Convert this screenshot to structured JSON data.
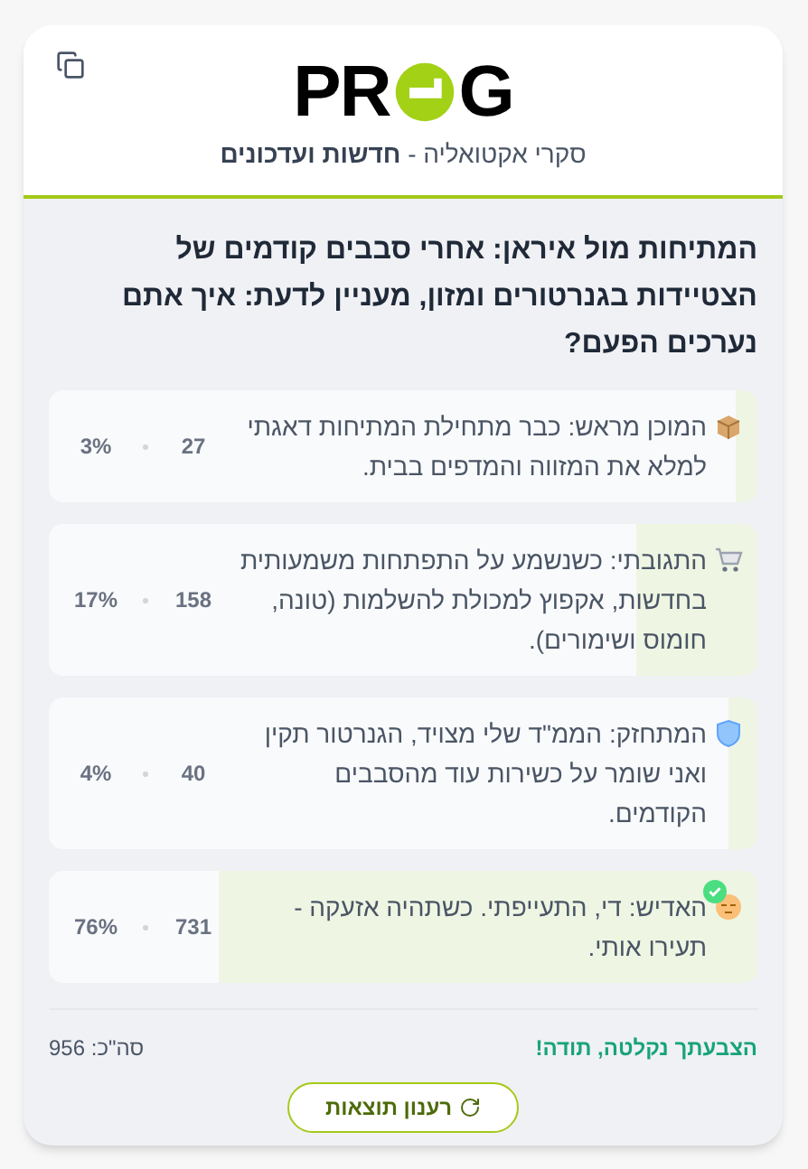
{
  "header": {
    "logo": {
      "before": "PR",
      "after": "G"
    },
    "tagline_regular": "סקרי אקטואליה - ",
    "tagline_bold": "חדשות ועדכונים"
  },
  "poll": {
    "question": "המתיחות מול איראן: אחרי סבבים קודמים של הצטיידות בגנרטורים ומזון, מעניין לדעת: איך אתם נערכים הפעם?",
    "options": [
      {
        "kind": "box",
        "label": "המוכן מראש: כבר מתחילת המתיחות דאגתי למלא את המזווה והמדפים בבית.",
        "count": "27",
        "percent": "3%",
        "level": 0.03,
        "selected": false
      },
      {
        "kind": "cart",
        "label": "התגובתי: כשנשמע על התפתחות משמעותית בחדשות, אקפוץ למכולת להשלמות (טונה, חומוס ושימורים).",
        "count": "158",
        "percent": "17%",
        "level": 0.17,
        "selected": false
      },
      {
        "kind": "shield",
        "label": "המתחזק: הממ\"ד שלי מצויד, הגנרטור תקין ואני שומר על כשירות עוד מהסבבים הקודמים.",
        "count": "40",
        "percent": "4%",
        "level": 0.04,
        "selected": false
      },
      {
        "kind": "sleepy",
        "label": "האדיש: די, התעייפתי. כשתהיה אזעקה - תעירו אותי.",
        "count": "731",
        "percent": "76%",
        "level": 0.76,
        "selected": true
      }
    ],
    "status": "הצבעתך נקלטה, תודה!",
    "total": "סה\"כ: 956",
    "refresh_button": "רענון תוצאות"
  }
}
